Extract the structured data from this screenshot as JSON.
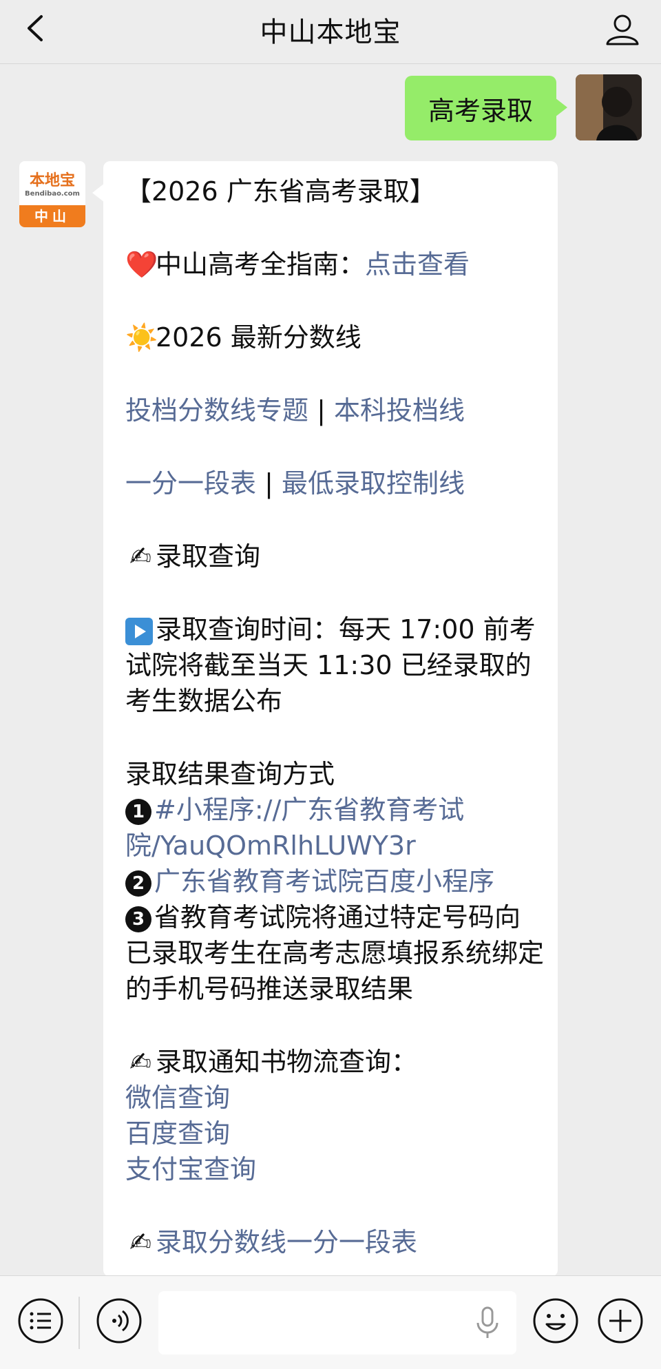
{
  "header": {
    "title": "中山本地宝"
  },
  "outgoing": {
    "text": "高考录取"
  },
  "bot": {
    "logo_text": "本地宝",
    "logo_sub": "Bendibao.com",
    "logo_band": "中山"
  },
  "message": {
    "title": "【2026 广东省高考录取】",
    "guide_prefix": "中山高考全指南：",
    "guide_link": "点击查看",
    "score_heading": "2026 最新分数线",
    "link_toudang_topic": "投档分数线专题",
    "separator": " | ",
    "link_benke": "本科投档线",
    "link_yifen": "一分一段表",
    "link_zuidi": "最低录取控制线",
    "query_heading": "录取查询",
    "query_time": "录取查询时间：每天 17:00 前考试院将截至当天 11:30 已经录取的考生数据公布",
    "result_methods": "录取结果查询方式",
    "method1_link": "#小程序://广东省教育考试院/YauQOmRlhLUWY3r",
    "method2_link": "广东省教育考试院百度小程序",
    "method3_text": "省教育考试院将通过特定号码向已录取考生在高考志愿填报系统绑定的手机号码推送录取结果",
    "notice_heading": "录取通知书物流查询：",
    "wechat_query": "微信查询",
    "baidu_query": "百度查询",
    "alipay_query": "支付宝查询",
    "last_heading": "录取分数线一分一段表",
    "num1": "1",
    "num2": "2",
    "num3": "3"
  },
  "icons": {
    "heart": "❤️",
    "sun": "☀️",
    "writing": "✍"
  },
  "colors": {
    "link": "#576b95",
    "outgoing_bubble": "#95ec69",
    "background": "#ededed"
  }
}
